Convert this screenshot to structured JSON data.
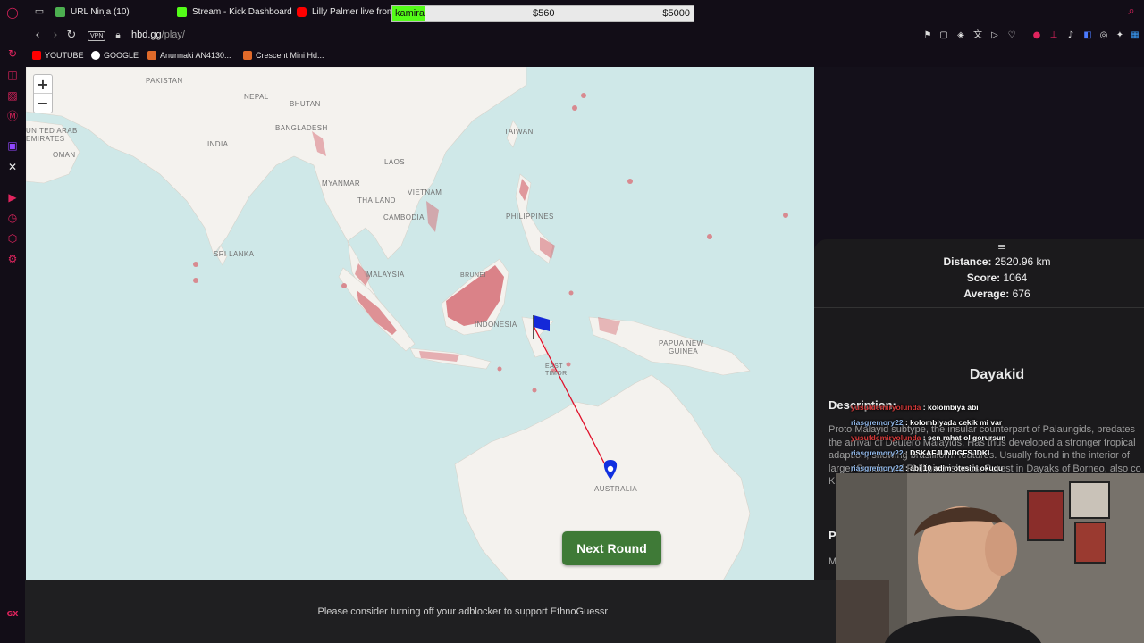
{
  "tabs": [
    {
      "label": "URL Ninja (10)",
      "color": "#4caf50"
    },
    {
      "label": "Stream - Kick Dashboard",
      "color": "#53fc18"
    },
    {
      "label": "Lilly Palmer live from he",
      "color": "#ff0000"
    }
  ],
  "overlay": {
    "name": "kamira",
    "value1": "$560",
    "value2": "$5000"
  },
  "address": {
    "vpn": "VPN",
    "url_domain": "hbd.gg",
    "url_path": "/play/"
  },
  "bookmarks": [
    {
      "label": "YOUTUBE",
      "color": "#ff0000"
    },
    {
      "label": "GOOGLE",
      "color": "#ffffff"
    },
    {
      "label": "Anunnaki AN4130...",
      "color": "#e06a2a"
    },
    {
      "label": "Crescent Mini Hd...",
      "color": "#e06a2a"
    }
  ],
  "map": {
    "zoom_in": "+",
    "zoom_out": "−",
    "labels": {
      "pakistan": "PAKISTAN",
      "nepal": "NEPAL",
      "bhutan": "BHUTAN",
      "bangladesh": "BANGLADESH",
      "india": "INDIA",
      "united_arab": "UNITED ARAB",
      "emirates": "EMIRATES",
      "oman": "OMAN",
      "taiwan": "TAIWAN",
      "laos": "LAOS",
      "myanmar": "MYANMAR",
      "vietnam": "VIETNAM",
      "thailand": "THAILAND",
      "cambodia": "CAMBODIA",
      "philippines": "PHILIPPINES",
      "sri_lanka": "SRI LANKA",
      "malaysia": "MALAYSIA",
      "brunei": "BRUNEI",
      "indonesia": "INDONESIA",
      "papua_new": "PAPUA NEW",
      "guinea": "GUINEA",
      "east": "EAST",
      "timor": "TIMOR",
      "australia": "AUSTRALIA"
    },
    "next_round": "Next Round",
    "colors": {
      "region": "#e07a80",
      "guess_line": "#e0102a",
      "flag": "#1428d8",
      "marker": "#1030e0"
    }
  },
  "panel": {
    "handle": "≡",
    "distance_label": "Distance:",
    "distance_value": "2520.96 km",
    "score_label": "Score:",
    "score_value": "1064",
    "average_label": "Average:",
    "average_value": "676",
    "name": "Dayakid",
    "description_label": "Description:",
    "description_text": "Proto Malayid subtype, the insular counterpart of Palaungids, predates the arrival of Deutero Malayids. Has thus developed a stronger tropical adaption, showing brasiliform features. Usually found in the interior of larger Sunda and Phillipine islands. Purest in Dayaks of Borneo, also co K Pe",
    "p_label": "P",
    "m_text": "M e"
  },
  "chat": [
    {
      "user": "yusufdemiryolunda",
      "user_color": "red",
      "msg": ": kolombiya abi"
    },
    {
      "user": "riasgremory22",
      "user_color": "blue",
      "msg": ": kolombiyada cekik mi var"
    },
    {
      "user": "yusufdemiryolunda",
      "user_color": "red",
      "msg": ": sen rahat ol gorursun"
    },
    {
      "user": "riasgremory22",
      "user_color": "blue",
      "msg": ": DSKAFJUNDGFSJDKL"
    },
    {
      "user": "riasgremory22",
      "user_color": "blue",
      "msg": ": abi 10 adim otesini okudu"
    }
  ],
  "footer": {
    "adblock": "Please consider turning off your adblocker to support EthnoGuessr"
  },
  "sidebar_icons": [
    "opera-logo-icon",
    "history-icon",
    "bag-icon",
    "paint-icon",
    "mail-icon",
    "twitch-icon",
    "x-icon",
    "player-icon",
    "clock-icon",
    "extensions-icon",
    "settings-icon",
    "gx-icon"
  ]
}
